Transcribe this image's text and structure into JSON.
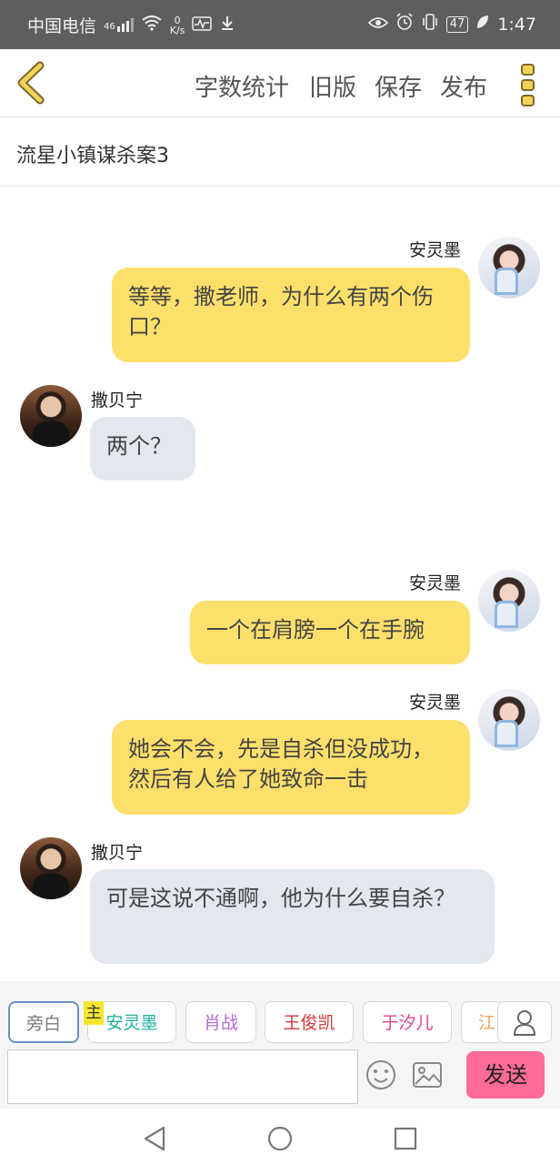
{
  "status_bar": {
    "carrier": "中国电信",
    "signal_label": "46",
    "speed_value": "0",
    "speed_unit": "K/s",
    "battery": "47",
    "time": "1:47"
  },
  "nav": {
    "word_count": "字数统计",
    "old_version": "旧版",
    "save": "保存",
    "publish": "发布"
  },
  "document": {
    "title": "流星小镇谋杀案3"
  },
  "messages": [
    {
      "speaker": "安灵墨",
      "side": "right",
      "text": "等等，撒老师，为什么有两个伤口？"
    },
    {
      "speaker": "撒贝宁",
      "side": "left",
      "text": "两个？"
    },
    {
      "speaker": "安灵墨",
      "side": "right",
      "text": "一个在肩膀一个在手腕"
    },
    {
      "speaker": "安灵墨",
      "side": "right",
      "text": "她会不会，先是自杀但没成功，然后有人给了她致命一击"
    },
    {
      "speaker": "撒贝宁",
      "side": "left",
      "text": "可是这说不通啊，他为什么要自杀？"
    }
  ],
  "roles": [
    {
      "label": "旁白",
      "color": "#7a7a7a"
    },
    {
      "label": "安灵墨",
      "color": "#20b2a0",
      "badge": "主"
    },
    {
      "label": "肖战",
      "color": "#b36bd6"
    },
    {
      "label": "王俊凯",
      "color": "#d23a3a"
    },
    {
      "label": "于汐儿",
      "color": "#e0428f"
    },
    {
      "label": "江",
      "color": "#f0a060"
    }
  ],
  "composer": {
    "input_value": "",
    "send": "发送"
  },
  "colors": {
    "bubble_self": "#fde06b",
    "bubble_other": "#e3e7ee",
    "send_button": "#ff6b98",
    "back_icon": "#e3c04a"
  }
}
